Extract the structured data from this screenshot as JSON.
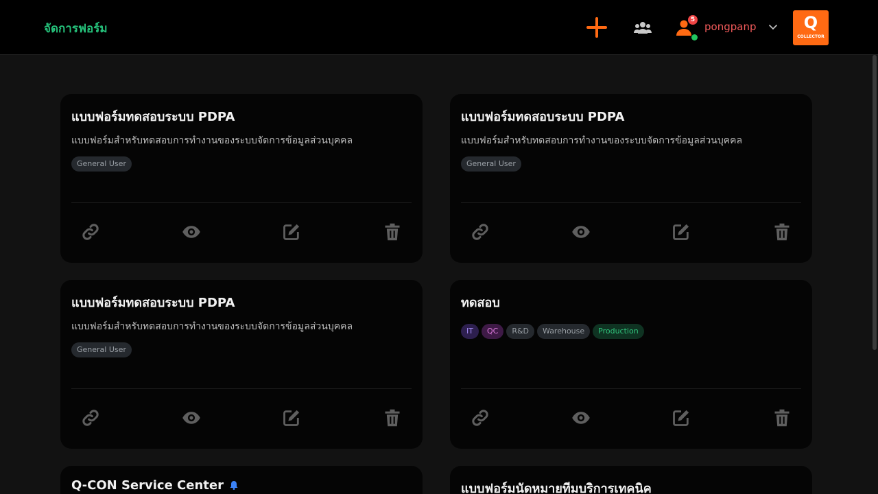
{
  "header": {
    "brand": "จัดการฟอร์ม",
    "add_icon": "plus-icon",
    "users_icon": "users-icon",
    "user_icon": "user-icon",
    "notification_count": "5",
    "username": "pongpanp",
    "logo_letter": "Q",
    "logo_text": "COLLECTOR"
  },
  "colors": {
    "brand": "#25c07a",
    "accent": "#ff6a13",
    "username": "#f05a5a",
    "badge": "#ef4444",
    "online": "#22c55e"
  },
  "cards": [
    {
      "title": "แบบฟอร์มทดสอบระบบ PDPA",
      "description": "แบบฟอร์มสำหรับทดสอบการทำงานของระบบจัดการข้อมูลส่วนบุคคล",
      "tags": [
        "General User"
      ]
    },
    {
      "title": "แบบฟอร์มทดสอบระบบ PDPA",
      "description": "แบบฟอร์มสำหรับทดสอบการทำงานของระบบจัดการข้อมูลส่วนบุคคล",
      "tags": [
        "General User"
      ]
    },
    {
      "title": "แบบฟอร์มทดสอบระบบ PDPA",
      "description": "แบบฟอร์มสำหรับทดสอบการทำงานของระบบจัดการข้อมูลส่วนบุคคล",
      "tags": [
        "General User"
      ]
    },
    {
      "title": "ทดสอบ",
      "description": "",
      "tags": [
        "IT",
        "QC",
        "R&D",
        "Warehouse",
        "Production"
      ]
    },
    {
      "title": "Q-CON Service Center",
      "title_icon": "bell-icon"
    },
    {
      "title": "แบบฟอร์มนัดหมายทีมบริการเทคนิค"
    }
  ],
  "card_actions": [
    "link-icon",
    "eye-icon",
    "edit-icon",
    "trash-icon"
  ]
}
